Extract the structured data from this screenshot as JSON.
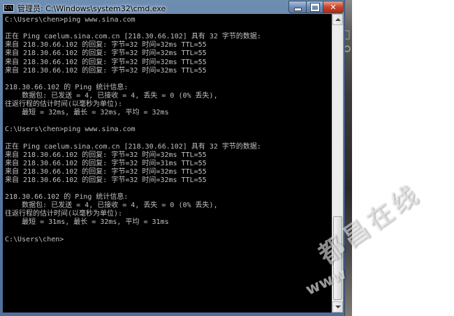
{
  "window": {
    "title": "管理员: C:\\Windows\\system32\\cmd.exe",
    "icon": "cmd-icon",
    "buttons": {
      "minimize_icon": "minimize-icon",
      "maximize_icon": "maximize-icon",
      "close_icon": "close-icon",
      "close_glyph": "✕"
    }
  },
  "console": {
    "lines": [
      "C:\\Users\\chen>ping www.sina.com",
      "",
      "正在 Ping caelum.sina.com.cn [218.30.66.102] 具有 32 字节的数据:",
      "来自 218.30.66.102 的回复: 字节=32 时间=32ms TTL=55",
      "来自 218.30.66.102 的回复: 字节=32 时间=32ms TTL=55",
      "来自 218.30.66.102 的回复: 字节=32 时间=32ms TTL=55",
      "来自 218.30.66.102 的回复: 字节=32 时间=32ms TTL=55",
      "",
      "218.30.66.102 的 Ping 统计信息:",
      "    数据包: 已发送 = 4, 已接收 = 4, 丢失 = 0 (0% 丢失),",
      "往返行程的估计时间(以毫秒为单位):",
      "    最短 = 32ms, 最长 = 32ms, 平均 = 32ms",
      "",
      "C:\\Users\\chen>ping www.sina.com",
      "",
      "正在 Ping caelum.sina.com.cn [218.30.66.102] 具有 32 字节的数据:",
      "来自 218.30.66.102 的回复: 字节=32 时间=32ms TTL=55",
      "来自 218.30.66.102 的回复: 字节=32 时间=31ms TTL=55",
      "来自 218.30.66.102 的回复: 字节=32 时间=32ms TTL=55",
      "来自 218.30.66.102 的回复: 字节=32 时间=32ms TTL=55",
      "",
      "218.30.66.102 的 Ping 统计信息:",
      "    数据包: 已发送 = 4, 已接收 = 4, 丢失 = 0 (0% 丢失),",
      "往返行程的估计时间(以毫秒为单位):",
      "    最短 = 31ms, 最长 = 32ms, 平均 = 31ms",
      "",
      "C:\\Users\\chen>"
    ]
  },
  "watermark": {
    "cn": "都昌在线",
    "en": "www"
  },
  "colors": {
    "console_bg": "#000000",
    "console_fg": "#c0c0c0",
    "frame": "#5a7aa3",
    "close_button": "#c9452c"
  }
}
